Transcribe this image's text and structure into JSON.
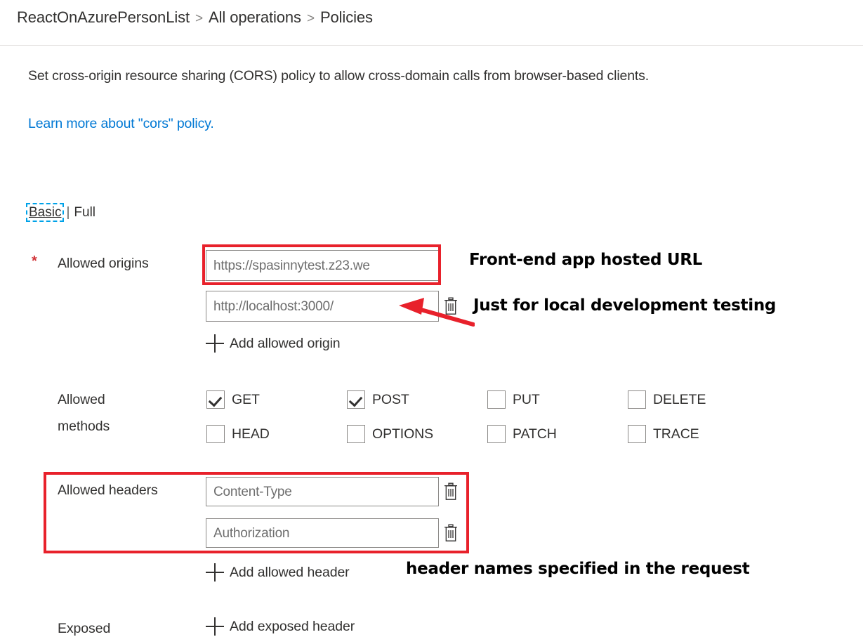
{
  "breadcrumb": {
    "items": [
      "ReactOnAzurePersonList",
      "All operations",
      "Policies"
    ],
    "separator": ">"
  },
  "description": "Set cross-origin resource sharing (CORS) policy to allow cross-domain calls from browser-based clients.",
  "learn_more_link": "Learn more about \"cors\" policy.",
  "view_toggle": {
    "basic": "Basic",
    "separator": "|",
    "full": "Full",
    "selected": "Basic",
    "focus_outline_color": "#00a2e8"
  },
  "fields": {
    "allowed_origins": {
      "label": "Allowed origins",
      "required_marker": "*",
      "values": [
        "https://spasinnytest.z23.we",
        "http://localhost:3000/"
      ],
      "add_label": "Add allowed origin"
    },
    "allowed_methods": {
      "label_line1": "Allowed",
      "label_line2": "methods",
      "options": [
        {
          "label": "GET",
          "checked": true
        },
        {
          "label": "POST",
          "checked": true
        },
        {
          "label": "PUT",
          "checked": false
        },
        {
          "label": "DELETE",
          "checked": false
        },
        {
          "label": "HEAD",
          "checked": false
        },
        {
          "label": "OPTIONS",
          "checked": false
        },
        {
          "label": "PATCH",
          "checked": false
        },
        {
          "label": "TRACE",
          "checked": false
        }
      ]
    },
    "allowed_headers": {
      "label": "Allowed headers",
      "values": [
        "Content-Type",
        "Authorization"
      ],
      "add_label": "Add allowed header"
    },
    "exposed_headers": {
      "label": "Exposed",
      "add_label": "Add exposed header"
    }
  },
  "annotations": {
    "origin_url": "Front-end app hosted URL",
    "localhost": "Just for local development testing",
    "headers": "header names specified in the request",
    "highlight_color": "#e8212b"
  },
  "icons": {
    "delete": "trash-icon",
    "add": "plus-icon"
  }
}
